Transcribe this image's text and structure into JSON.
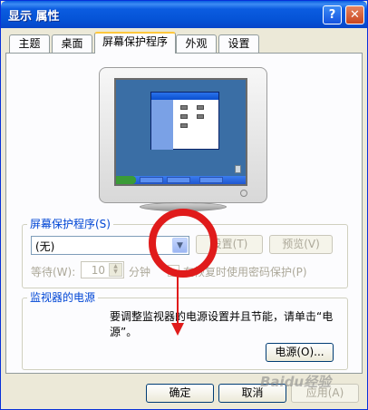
{
  "window": {
    "title": "显示 属性",
    "help_label": "?",
    "close_label": "✕"
  },
  "tabs": [
    {
      "label": "主题",
      "active": false
    },
    {
      "label": "桌面",
      "active": false
    },
    {
      "label": "屏幕保护程序",
      "active": true
    },
    {
      "label": "外观",
      "active": false
    },
    {
      "label": "设置",
      "active": false
    }
  ],
  "screensaver": {
    "group_label": "屏幕保护程序(S)",
    "combo_value": "(无)",
    "settings_button": "设置(T)",
    "preview_button": "预览(V)",
    "wait_label": "等待(W):",
    "wait_value": "10",
    "minutes_label": "分钟",
    "password_label": "在恢复时使用密码保护(P)"
  },
  "monitor_power": {
    "group_label": "监视器的电源",
    "description": "要调整监视器的电源设置并且节能，请单击“电源”。",
    "power_button": "电源(O)..."
  },
  "dialog_buttons": {
    "ok": "确定",
    "cancel": "取消",
    "apply": "应用(A)"
  },
  "watermark": "Baidu经验",
  "colors": {
    "titlebar": "#0553d6",
    "annotation": "#e01b1b",
    "group_label": "#0046d5"
  }
}
